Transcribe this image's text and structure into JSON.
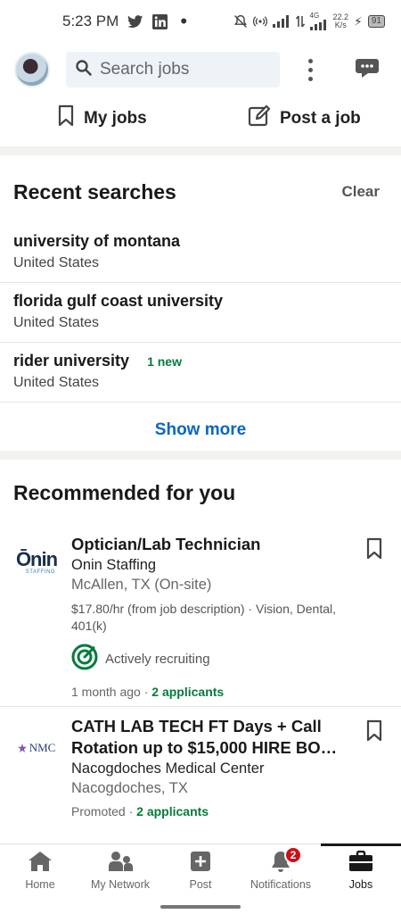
{
  "status_bar": {
    "time": "5:23 PM",
    "net_speed_value": "22.2",
    "net_speed_unit": "K/s",
    "network_label": "4G",
    "battery": "91"
  },
  "search": {
    "placeholder": "Search jobs"
  },
  "actions": {
    "my_jobs": "My jobs",
    "post_job": "Post a job"
  },
  "recent": {
    "title": "Recent searches",
    "clear": "Clear",
    "items": [
      {
        "query": "university of montana",
        "location": "United States",
        "badge": ""
      },
      {
        "query": "florida gulf coast university",
        "location": "United States",
        "badge": ""
      },
      {
        "query": "rider university",
        "location": "United States",
        "badge": "1 new"
      }
    ],
    "show_more": "Show more"
  },
  "recommended": {
    "title": "Recommended for you",
    "jobs": [
      {
        "logo_text": "Ōnin",
        "logo_sub": "STAFFING",
        "title": "Optician/Lab Technician",
        "company": "Onin Staffing",
        "location": "McAllen, TX (On-site)",
        "details": "$17.80/hr (from job description) · Vision, Dental, 401(k)",
        "recruiting": "Actively recruiting",
        "posted": "1 month ago",
        "separator": " · ",
        "applicants": "2 applicants"
      },
      {
        "logo_text": "NMC",
        "title": "CATH LAB TECH FT Days + Call Rotation up to $15,000 HIRE BO…",
        "company": "Nacogdoches Medical Center",
        "location": "Nacogdoches, TX",
        "posted": "Promoted",
        "separator": " · ",
        "applicants": "2 applicants"
      }
    ]
  },
  "bottom_nav": {
    "items": [
      {
        "label": "Home"
      },
      {
        "label": "My Network"
      },
      {
        "label": "Post"
      },
      {
        "label": "Notifications",
        "badge": "2"
      },
      {
        "label": "Jobs"
      }
    ]
  },
  "colors": {
    "accent": "#0a66c2",
    "green": "#067a3e",
    "badge_red": "#cc1016"
  }
}
